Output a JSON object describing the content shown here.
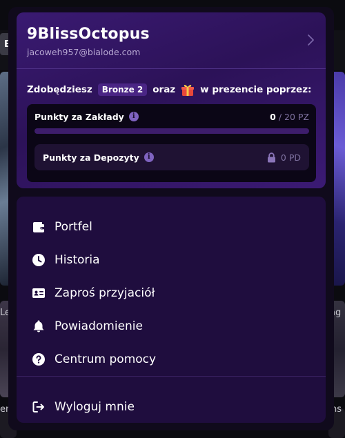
{
  "background": {
    "chip_letter": "E",
    "fragments": [
      "Le",
      "ag",
      "en",
      "ns"
    ]
  },
  "profile": {
    "username": "9BlissOctopus",
    "email": "jacoweh957@bialode.com"
  },
  "promo": {
    "prefix": "Zdobędziesz",
    "badge": "Bronze 2",
    "middle": "oraz",
    "suffix": "w prezencie poprzez:"
  },
  "points": {
    "bets": {
      "label": "Punkty za Zakłady",
      "current": "0",
      "total": "/ 20 PZ",
      "progress_fraction": 0
    },
    "deposits": {
      "label": "Punkty za Depozyty",
      "value": "0 PD"
    }
  },
  "menu": {
    "wallet": "Portfel",
    "history": "Historia",
    "invite": "Zaproś przyjaciół",
    "notifications": "Powiadomienie",
    "help": "Centrum pomocy",
    "logout": "Wyloguj mnie"
  },
  "icons": {
    "wallet": "wallet-icon",
    "history": "clock-icon",
    "invite": "id-card-icon",
    "notifications": "bell-icon",
    "help": "question-circle-icon",
    "logout": "logout-icon",
    "info": "info-icon",
    "lock": "lock-icon",
    "gift": "gift-icon",
    "chevron": "chevron-right-icon"
  },
  "colors": {
    "accent": "#8a5cff",
    "panel": "#1f0d3e",
    "profile_gradient_start": "#3a1a72",
    "badge_bg": "#4a2585"
  }
}
